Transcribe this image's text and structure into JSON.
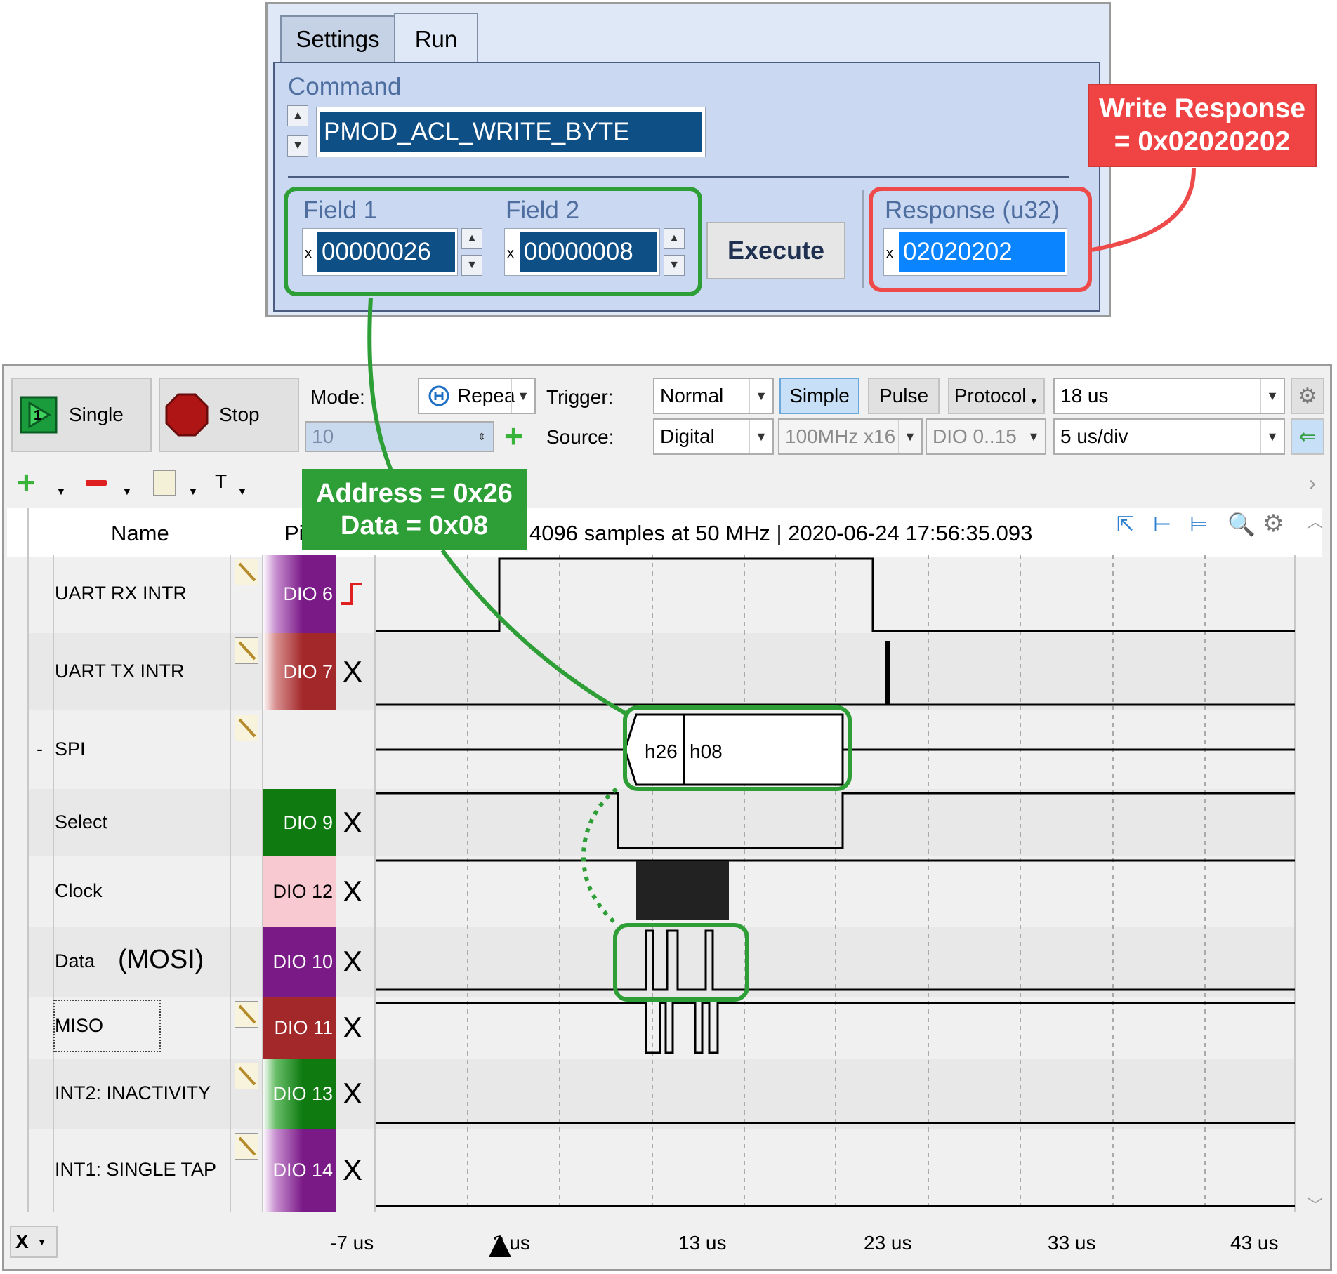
{
  "command_panel": {
    "tabs": [
      "Settings",
      "Run"
    ],
    "active_tab": "Run",
    "command_label": "Command",
    "command_value": "PMOD_ACL_WRITE_BYTE",
    "field1_label": "Field 1",
    "field1_value": "00000026",
    "field2_label": "Field 2",
    "field2_value": "00000008",
    "hex_prefix": "x",
    "execute_label": "Execute",
    "response_label": "Response (u32)",
    "response_value": "02020202"
  },
  "annotations": {
    "write_response_line1": "Write Response",
    "write_response_line2": "= 0x02020202",
    "address_line": "Address = 0x26",
    "data_line": "Data = 0x08",
    "mosi_label": "(MOSI)"
  },
  "toolbar": {
    "single_label": "Single",
    "stop_label": "Stop",
    "mode_label": "Mode:",
    "mode_value": "Repea",
    "count_value": "10",
    "trigger_label": "Trigger:",
    "trigger_value": "Normal",
    "simple_label": "Simple",
    "pulse_label": "Pulse",
    "protocol_label": "Protocol",
    "position_value": "18 us",
    "source_label": "Source:",
    "source_value": "Digital",
    "rate_value": "100MHz x16",
    "dio_range_value": "DIO 0..15",
    "timebase_value": "5 us/div",
    "text_tool": "T"
  },
  "channel_list": {
    "name_header": "Name",
    "pin_header_visible": "Pi",
    "acquisition_info": "4096 samples at 50 MHz | 2020-06-24 17:56:35.093",
    "collapse_marker": "-",
    "rows": [
      {
        "name": "UART RX INTR",
        "pin": "DIO  6"
      },
      {
        "name": "UART TX INTR",
        "pin": "DIO  7",
        "trigger": "X"
      },
      {
        "name": "SPI"
      },
      {
        "name": "Select",
        "pin": "DIO  9",
        "trigger": "X"
      },
      {
        "name": "Clock",
        "pin": "DIO 12",
        "trigger": "X"
      },
      {
        "name": "Data",
        "pin": "DIO 10",
        "trigger": "X"
      },
      {
        "name": "MISO",
        "pin": "DIO 11",
        "trigger": "X"
      },
      {
        "name": "INT2: INACTIVITY",
        "pin": "DIO 13",
        "trigger": "X"
      },
      {
        "name": "INT1: SINGLE TAP",
        "pin": "DIO 14",
        "trigger": "X"
      }
    ],
    "spi_bytes": [
      "h26",
      "h08"
    ]
  },
  "time_axis": {
    "labels": [
      "-7 us",
      "3 us",
      "13 us",
      "23 us",
      "33 us",
      "43 us"
    ],
    "x_button": "X"
  },
  "colors": {
    "green_annotation": "#2e9e36",
    "red_annotation": "#f04444",
    "pin_purple": "#7a1a87",
    "pin_red": "#a3282a",
    "pin_green": "#0e7a10",
    "pin_pink": "#f9c9d2"
  }
}
